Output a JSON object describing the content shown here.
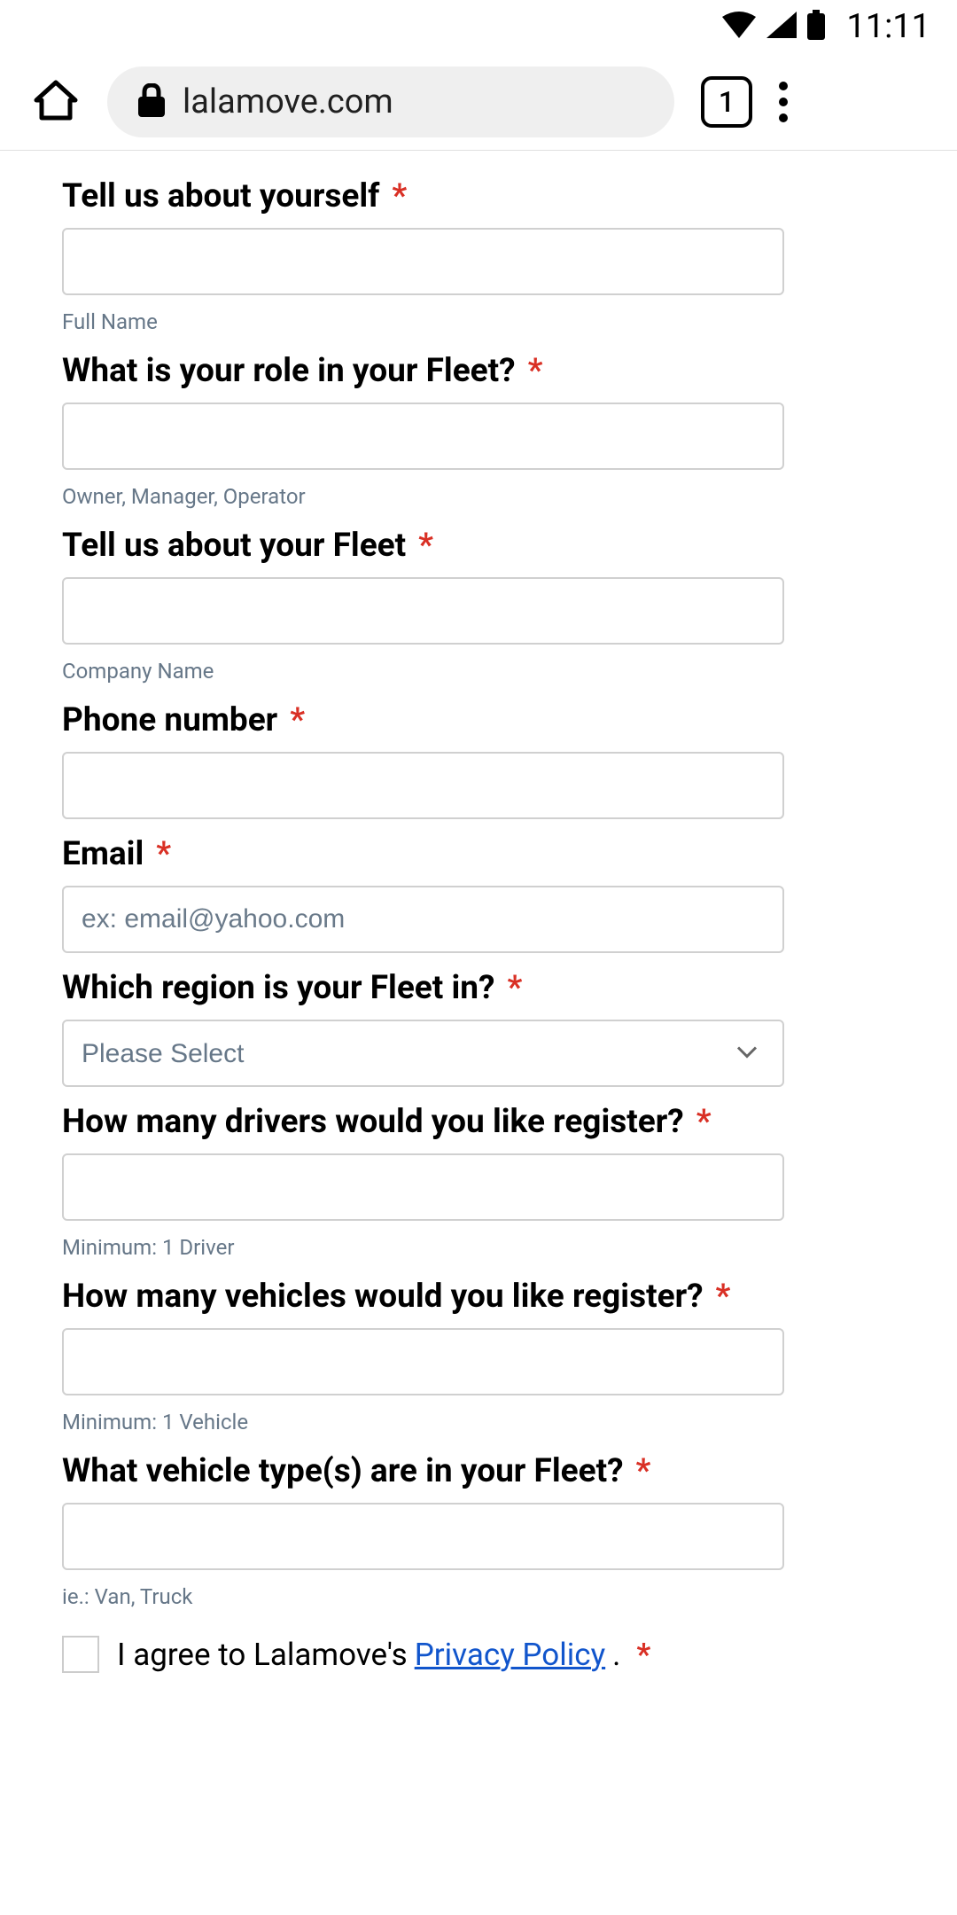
{
  "status": {
    "time": "11:11"
  },
  "browser": {
    "url": "lalamove.com",
    "tab_count": "1"
  },
  "form": {
    "field1": {
      "label": "Tell us about yourself",
      "sublabel": "Full Name"
    },
    "field2": {
      "label": "What is your role in your Fleet?",
      "sublabel": "Owner, Manager, Operator"
    },
    "field3": {
      "label": "Tell us about your Fleet",
      "sublabel": "Company Name"
    },
    "field4": {
      "label": "Phone number"
    },
    "field5": {
      "label": "Email",
      "placeholder": "ex: email@yahoo.com"
    },
    "field6": {
      "label": "Which region is your Fleet in?",
      "placeholder": "Please Select"
    },
    "field7": {
      "label": "How many drivers would you like register?",
      "sublabel": "Minimum: 1 Driver"
    },
    "field8": {
      "label": "How many vehicles would you like register?",
      "sublabel": "Minimum: 1 Vehicle"
    },
    "field9": {
      "label": "What vehicle type(s) are in your Fleet?",
      "sublabel": "ie.: Van, Truck"
    },
    "consent": {
      "prefix": "I agree to Lalamove's ",
      "link": "Privacy Policy",
      "suffix": "."
    }
  }
}
